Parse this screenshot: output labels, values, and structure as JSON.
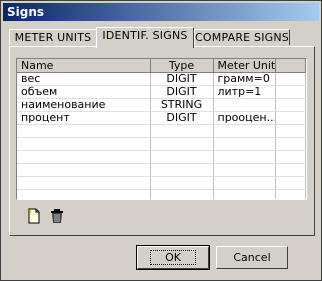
{
  "window": {
    "title": "Signs"
  },
  "tabs": [
    {
      "label": "METER UNITS"
    },
    {
      "label": "IDENTIF. SIGNS"
    },
    {
      "label": "COMPARE SIGNS"
    }
  ],
  "table": {
    "columns": [
      "Name",
      "Type",
      "Meter Unit"
    ],
    "rows": [
      {
        "name": "вес",
        "type": "DIGIT",
        "unit": "грамм=0"
      },
      {
        "name": "объем",
        "type": "DIGIT",
        "unit": "литр=1"
      },
      {
        "name": "наименование",
        "type": "STRING",
        "unit": ""
      },
      {
        "name": "процент",
        "type": "DIGIT",
        "unit": "прооцен..."
      }
    ]
  },
  "toolbar": {
    "icons": [
      "new-document-icon",
      "trash-icon"
    ]
  },
  "buttons": {
    "ok": "OK",
    "cancel": "Cancel"
  }
}
